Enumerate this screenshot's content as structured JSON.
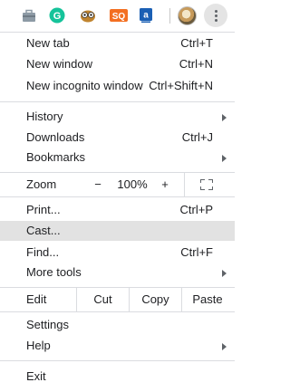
{
  "toolbar": {
    "extensions": [
      {
        "name": "briefcase-extension-icon",
        "color": "#7d8b96"
      },
      {
        "name": "grammarly-icon",
        "color": "#15c39a",
        "text": "G"
      },
      {
        "name": "owl-extension-icon",
        "color": "#c0842f"
      },
      {
        "name": "sq-extension-icon",
        "color": "#f36f21",
        "text": "SQ"
      },
      {
        "name": "a-extension-icon",
        "color": "#1a5fb4",
        "text": "a"
      }
    ]
  },
  "menu": {
    "new_tab": {
      "label": "New tab",
      "shortcut": "Ctrl+T"
    },
    "new_window": {
      "label": "New window",
      "shortcut": "Ctrl+N"
    },
    "new_incognito": {
      "label": "New incognito window",
      "shortcut": "Ctrl+Shift+N"
    },
    "history": {
      "label": "History"
    },
    "downloads": {
      "label": "Downloads",
      "shortcut": "Ctrl+J"
    },
    "bookmarks": {
      "label": "Bookmarks"
    },
    "zoom": {
      "label": "Zoom",
      "minus": "−",
      "level": "100%",
      "plus": "+"
    },
    "print": {
      "label": "Print...",
      "shortcut": "Ctrl+P"
    },
    "cast": {
      "label": "Cast..."
    },
    "find": {
      "label": "Find...",
      "shortcut": "Ctrl+F"
    },
    "more_tools": {
      "label": "More tools"
    },
    "edit": {
      "label": "Edit",
      "cut": "Cut",
      "copy": "Copy",
      "paste": "Paste"
    },
    "settings": {
      "label": "Settings"
    },
    "help": {
      "label": "Help"
    },
    "exit": {
      "label": "Exit"
    }
  },
  "colors": {
    "highlight": "#e2e2e2",
    "separator": "#dadce0",
    "text": "#202124"
  }
}
